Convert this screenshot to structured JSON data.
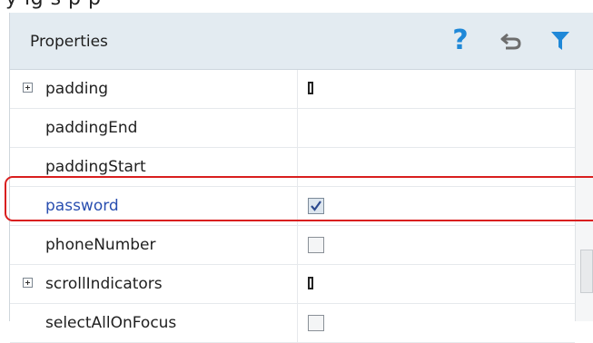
{
  "top_fragment": "y ig        s    p                          p",
  "panel": {
    "title": "Properties",
    "icons": [
      "help-icon",
      "undo-icon",
      "filter-icon"
    ],
    "accent_color": "#1f88d8",
    "selected_color": "#2a4fb0",
    "highlight_color": "#d91f1f"
  },
  "rows": [
    {
      "name": "padding",
      "expandable": true,
      "value": "box"
    },
    {
      "name": "paddingEnd",
      "expandable": false,
      "value": ""
    },
    {
      "name": "paddingStart",
      "expandable": false,
      "value": ""
    },
    {
      "name": "password",
      "expandable": false,
      "value": "checkbox",
      "checked": true,
      "selected": true
    },
    {
      "name": "phoneNumber",
      "expandable": false,
      "value": "checkbox",
      "checked": false
    },
    {
      "name": "scrollIndicators",
      "expandable": true,
      "value": "box"
    },
    {
      "name": "selectAllOnFocus",
      "expandable": false,
      "value": "checkbox",
      "checked": false
    }
  ]
}
